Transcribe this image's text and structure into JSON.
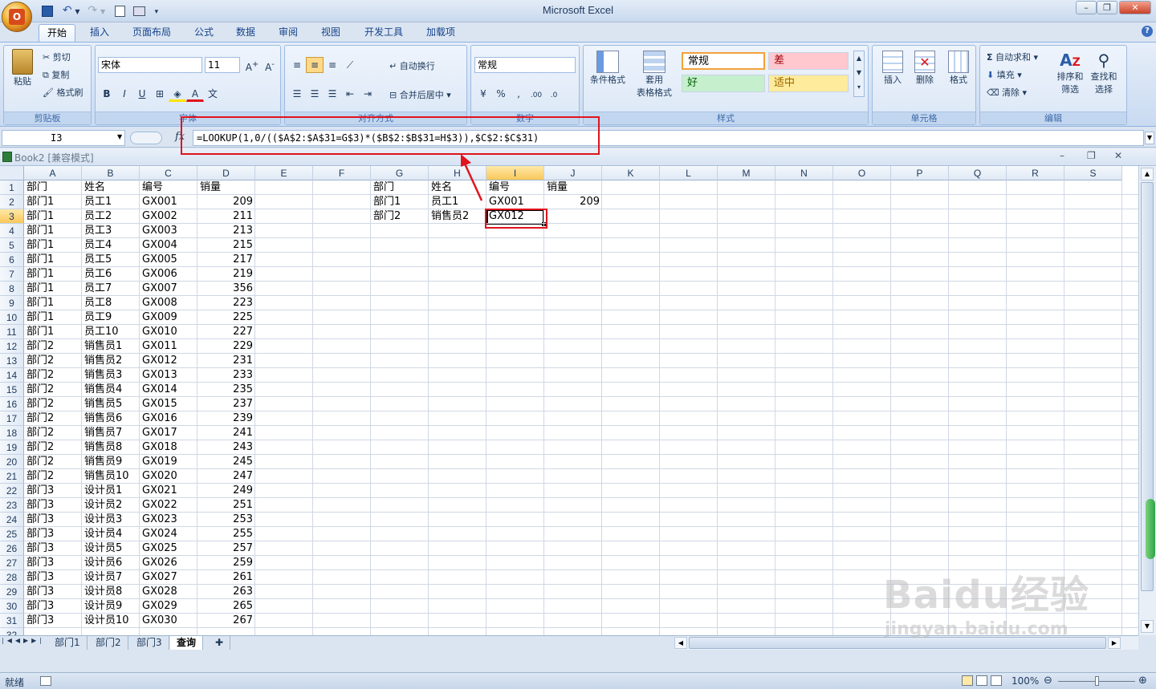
{
  "window": {
    "title": "Microsoft Excel"
  },
  "office_button": {
    "label": "O"
  },
  "window_controls": {
    "minimize": "–",
    "restore": "❐",
    "close": "✕"
  },
  "tabs": [
    "开始",
    "插入",
    "页面布局",
    "公式",
    "数据",
    "审阅",
    "视图",
    "开发工具",
    "加载项"
  ],
  "ribbon": {
    "clipboard": {
      "paste": "粘贴",
      "cut": "剪切",
      "copy": "复制",
      "format_painter": "格式刷",
      "label": "剪贴板"
    },
    "font": {
      "name": "宋体",
      "size": "11",
      "label": "字体"
    },
    "alignment": {
      "wrap": "自动换行",
      "merge": "合并后居中",
      "label": "对齐方式"
    },
    "number": {
      "format": "常规",
      "label": "数字"
    },
    "styles": {
      "conditional": "条件格式",
      "table1": "套用",
      "table2": "表格格式",
      "normal": "常规",
      "bad": "差",
      "good": "好",
      "neutral": "适中",
      "label": "样式"
    },
    "cells": {
      "insert": "插入",
      "delete": "删除",
      "format": "格式",
      "label": "单元格"
    },
    "editing": {
      "autosum": "自动求和",
      "fill": "填充",
      "clear": "清除",
      "sort1": "排序和",
      "sort2": "筛选",
      "find1": "查找和",
      "find2": "选择",
      "label": "编辑"
    }
  },
  "formula_bar": {
    "name_box": "I3",
    "fx": "fx",
    "formula": "=LOOKUP(1,0/(($A$2:$A$31=G$3)*($B$2:$B$31=H$3)),$C$2:$C$31)"
  },
  "workbook": {
    "title": "Book2  [兼容模式]"
  },
  "columns": [
    "A",
    "B",
    "C",
    "D",
    "E",
    "F",
    "G",
    "H",
    "I",
    "J",
    "K",
    "L",
    "M",
    "N",
    "O",
    "P",
    "Q",
    "R",
    "S"
  ],
  "table_left": {
    "headers": [
      "部门",
      "姓名",
      "编号",
      "销量"
    ],
    "rows": [
      [
        "部门1",
        "员工1",
        "GX001",
        "209"
      ],
      [
        "部门1",
        "员工2",
        "GX002",
        "211"
      ],
      [
        "部门1",
        "员工3",
        "GX003",
        "213"
      ],
      [
        "部门1",
        "员工4",
        "GX004",
        "215"
      ],
      [
        "部门1",
        "员工5",
        "GX005",
        "217"
      ],
      [
        "部门1",
        "员工6",
        "GX006",
        "219"
      ],
      [
        "部门1",
        "员工7",
        "GX007",
        "356"
      ],
      [
        "部门1",
        "员工8",
        "GX008",
        "223"
      ],
      [
        "部门1",
        "员工9",
        "GX009",
        "225"
      ],
      [
        "部门1",
        "员工10",
        "GX010",
        "227"
      ],
      [
        "部门2",
        "销售员1",
        "GX011",
        "229"
      ],
      [
        "部门2",
        "销售员2",
        "GX012",
        "231"
      ],
      [
        "部门2",
        "销售员3",
        "GX013",
        "233"
      ],
      [
        "部门2",
        "销售员4",
        "GX014",
        "235"
      ],
      [
        "部门2",
        "销售员5",
        "GX015",
        "237"
      ],
      [
        "部门2",
        "销售员6",
        "GX016",
        "239"
      ],
      [
        "部门2",
        "销售员7",
        "GX017",
        "241"
      ],
      [
        "部门2",
        "销售员8",
        "GX018",
        "243"
      ],
      [
        "部门2",
        "销售员9",
        "GX019",
        "245"
      ],
      [
        "部门2",
        "销售员10",
        "GX020",
        "247"
      ],
      [
        "部门3",
        "设计员1",
        "GX021",
        "249"
      ],
      [
        "部门3",
        "设计员2",
        "GX022",
        "251"
      ],
      [
        "部门3",
        "设计员3",
        "GX023",
        "253"
      ],
      [
        "部门3",
        "设计员4",
        "GX024",
        "255"
      ],
      [
        "部门3",
        "设计员5",
        "GX025",
        "257"
      ],
      [
        "部门3",
        "设计员6",
        "GX026",
        "259"
      ],
      [
        "部门3",
        "设计员7",
        "GX027",
        "261"
      ],
      [
        "部门3",
        "设计员8",
        "GX028",
        "263"
      ],
      [
        "部门3",
        "设计员9",
        "GX029",
        "265"
      ],
      [
        "部门3",
        "设计员10",
        "GX030",
        "267"
      ]
    ]
  },
  "table_right": {
    "headers": [
      "部门",
      "姓名",
      "编号",
      "销量"
    ],
    "rows": [
      [
        "部门1",
        "员工1",
        "GX001",
        "209"
      ],
      [
        "部门2",
        "销售员2",
        "GX012",
        ""
      ]
    ]
  },
  "sheet_tabs": [
    "部门1",
    "部门2",
    "部门3",
    "查询"
  ],
  "active_sheet": "查询",
  "status": {
    "ready": "就绪",
    "zoom": "100%"
  },
  "watermark": {
    "brand": "Baidu经验",
    "url": "jingyan.baidu.com"
  },
  "colors": {
    "accent": "#15428b",
    "annotation": "#e0141e",
    "ribbon_bg": "#dbe5f1",
    "selected_header": "#f9c75b"
  }
}
